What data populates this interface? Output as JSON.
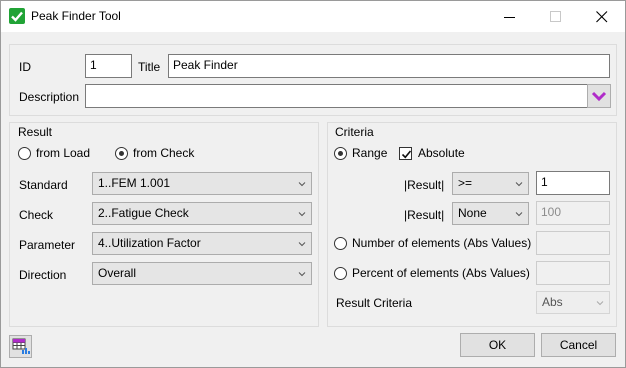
{
  "window": {
    "title": "Peak Finder Tool",
    "controls": [
      "minimize-icon",
      "maximize-icon",
      "close-icon"
    ]
  },
  "header": {
    "id_label": "ID",
    "id_value": "1",
    "title_label": "Title",
    "title_value": "Peak Finder",
    "description_label": "Description",
    "description_value": ""
  },
  "result": {
    "group_label": "Result",
    "from_load_label": "from Load",
    "from_check_label": "from Check",
    "selected_source": "from Check",
    "standard_label": "Standard",
    "standard_value": "1..FEM 1.001",
    "check_label": "Check",
    "check_value": "2..Fatigue Check",
    "parameter_label": "Parameter",
    "parameter_value": "4..Utilization Factor",
    "direction_label": "Direction",
    "direction_value": "Overall"
  },
  "criteria": {
    "group_label": "Criteria",
    "range_label": "Range",
    "range_selected": true,
    "absolute_label": "Absolute",
    "absolute_checked": true,
    "result1_label": "|Result|",
    "op1_value": ">=",
    "value1": "1",
    "result2_label": "|Result|",
    "op2_value": "None",
    "value2": "100",
    "num_elements_label": "Number of elements (Abs Values)",
    "num_elements_value": "",
    "pct_elements_label": "Percent of elements (Abs Values)",
    "pct_elements_value": "",
    "result_criteria_label": "Result Criteria",
    "result_criteria_value": "Abs"
  },
  "footer": {
    "ok_label": "OK",
    "cancel_label": "Cancel"
  },
  "colors": {
    "accent_purple": "#b02bc9",
    "app_icon_green": "#21a336"
  }
}
